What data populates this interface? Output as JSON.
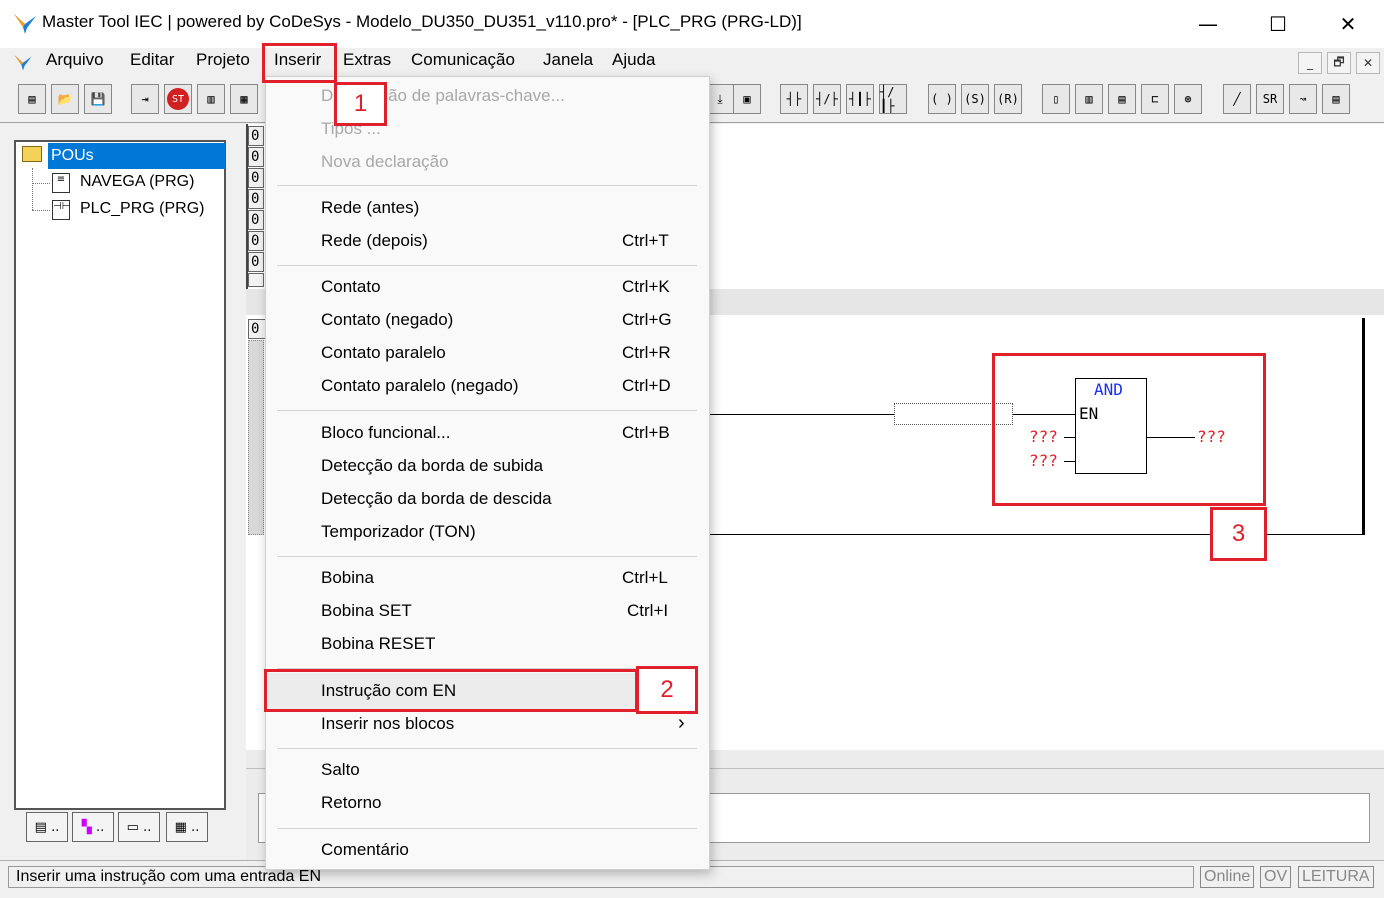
{
  "window": {
    "title": "Master Tool IEC | powered by CoDeSys - Modelo_DU350_DU351_v110.pro* - [PLC_PRG (PRG-LD)]",
    "minimize": "—",
    "maximize": "☐",
    "close": "✕"
  },
  "menubar": {
    "items": [
      "Arquivo",
      "Editar",
      "Projeto",
      "Inserir",
      "Extras",
      "Comunicação",
      "Janela",
      "Ajuda"
    ],
    "mdi": [
      "_",
      "🗗",
      "✕"
    ]
  },
  "toolbar": {
    "buttons": [
      "new",
      "open",
      "save",
      "login",
      "stop",
      "run",
      "step",
      "break",
      "ld-contact",
      "ld-contact-neg",
      "ld-parallel",
      "ld-parallel-neg",
      "coil",
      "coil-set",
      "coil-reset",
      "box",
      "box-en",
      "fb",
      "fb2",
      "fb3",
      "line",
      "set-reset",
      "jump",
      "comment"
    ],
    "glyphs": {
      "contact": "┤├",
      "contact_neg": "┤/├",
      "par": "┤┃├",
      "par_neg": "┤/┃├",
      "coil": "( )",
      "coil_s": "(S)",
      "coil_r": "(R)",
      "sr": "SR"
    }
  },
  "tree": {
    "root": "POUs",
    "items": [
      "NAVEGA (PRG)",
      "PLC_PRG (PRG)"
    ]
  },
  "bottom_tabs": [
    "..",
    "..",
    "..",
    ".."
  ],
  "line_numbers": [
    "0",
    "0",
    "0",
    "0",
    "0",
    "0",
    "0",
    "0",
    "0",
    "0"
  ],
  "ld": {
    "block_name": "AND",
    "en_label": "EN",
    "input1": "???",
    "input2": "???",
    "output": "???"
  },
  "dropdown": {
    "items": [
      {
        "label": "Declaração de palavras-chave...",
        "shortcut": "",
        "disabled": true
      },
      {
        "label": "Tipos ...",
        "shortcut": "",
        "disabled": true
      },
      {
        "label": "Nova declaração",
        "shortcut": "",
        "disabled": true
      },
      {
        "label": "Rede (antes)",
        "shortcut": ""
      },
      {
        "label": "Rede (depois)",
        "shortcut": "Ctrl+T"
      },
      {
        "label": "Contato",
        "shortcut": "Ctrl+K"
      },
      {
        "label": "Contato (negado)",
        "shortcut": "Ctrl+G"
      },
      {
        "label": "Contato paralelo",
        "shortcut": "Ctrl+R"
      },
      {
        "label": "Contato paralelo (negado)",
        "shortcut": "Ctrl+D"
      },
      {
        "label": "Bloco funcional...",
        "shortcut": "Ctrl+B"
      },
      {
        "label": "Detecção da borda de subida",
        "shortcut": ""
      },
      {
        "label": "Detecção da borda de descida",
        "shortcut": ""
      },
      {
        "label": "Temporizador (TON)",
        "shortcut": ""
      },
      {
        "label": "Bobina",
        "shortcut": "Ctrl+L"
      },
      {
        "label": "Bobina SET",
        "shortcut": "Ctrl+I"
      },
      {
        "label": "Bobina RESET",
        "shortcut": ""
      },
      {
        "label": "Instrução com EN",
        "shortcut": ""
      },
      {
        "label": "Inserir nos blocos",
        "shortcut": "›"
      },
      {
        "label": "Salto",
        "shortcut": ""
      },
      {
        "label": "Retorno",
        "shortcut": ""
      },
      {
        "label": "Comentário",
        "shortcut": ""
      }
    ]
  },
  "callouts": [
    "1",
    "2",
    "3"
  ],
  "status": {
    "message": "Inserir uma instrução com uma entrada EN",
    "online": "Online",
    "ov": "OV",
    "leitura": "LEITURA"
  },
  "colors": {
    "accent_red": "#e0202a",
    "selection_blue": "#0078d7",
    "ld_keyword_blue": "#1a2ef0",
    "ld_placeholder_red": "#e0202a"
  }
}
